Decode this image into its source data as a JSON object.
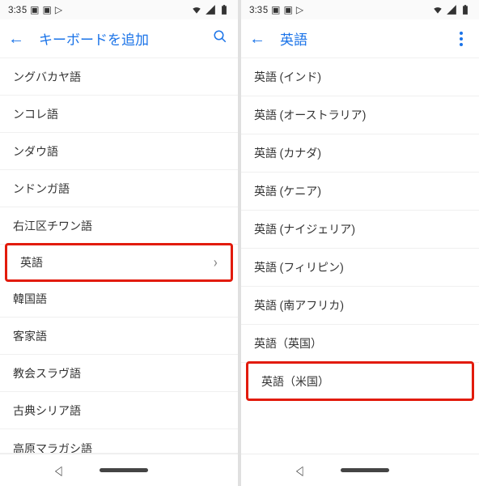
{
  "status": {
    "time": "3:35",
    "left_icons": [
      "image-icon",
      "image-icon",
      "play-icon"
    ],
    "right_icons": [
      "wifi-icon",
      "signal-icon",
      "battery-icon"
    ]
  },
  "left_screen": {
    "title": "キーボードを追加",
    "search_icon": "search",
    "items": [
      "ングバカヤ語",
      "ンコレ語",
      "ンダウ語",
      "ンドンガ語",
      "右江区チワン語",
      "英語",
      "韓国語",
      "客家語",
      "教会スラヴ語",
      "古典シリア語",
      "高原マラガシ語"
    ],
    "highlight_index": 5,
    "chevron_index": 5
  },
  "right_screen": {
    "title": "英語",
    "more_icon": "more-vert",
    "items": [
      "英語 (インド)",
      "英語 (オーストラリア)",
      "英語 (カナダ)",
      "英語 (ケニア)",
      "英語 (ナイジェリア)",
      "英語 (フィリピン)",
      "英語 (南アフリカ)",
      "英語（英国）",
      "英語（米国）"
    ],
    "highlight_index": 8
  }
}
